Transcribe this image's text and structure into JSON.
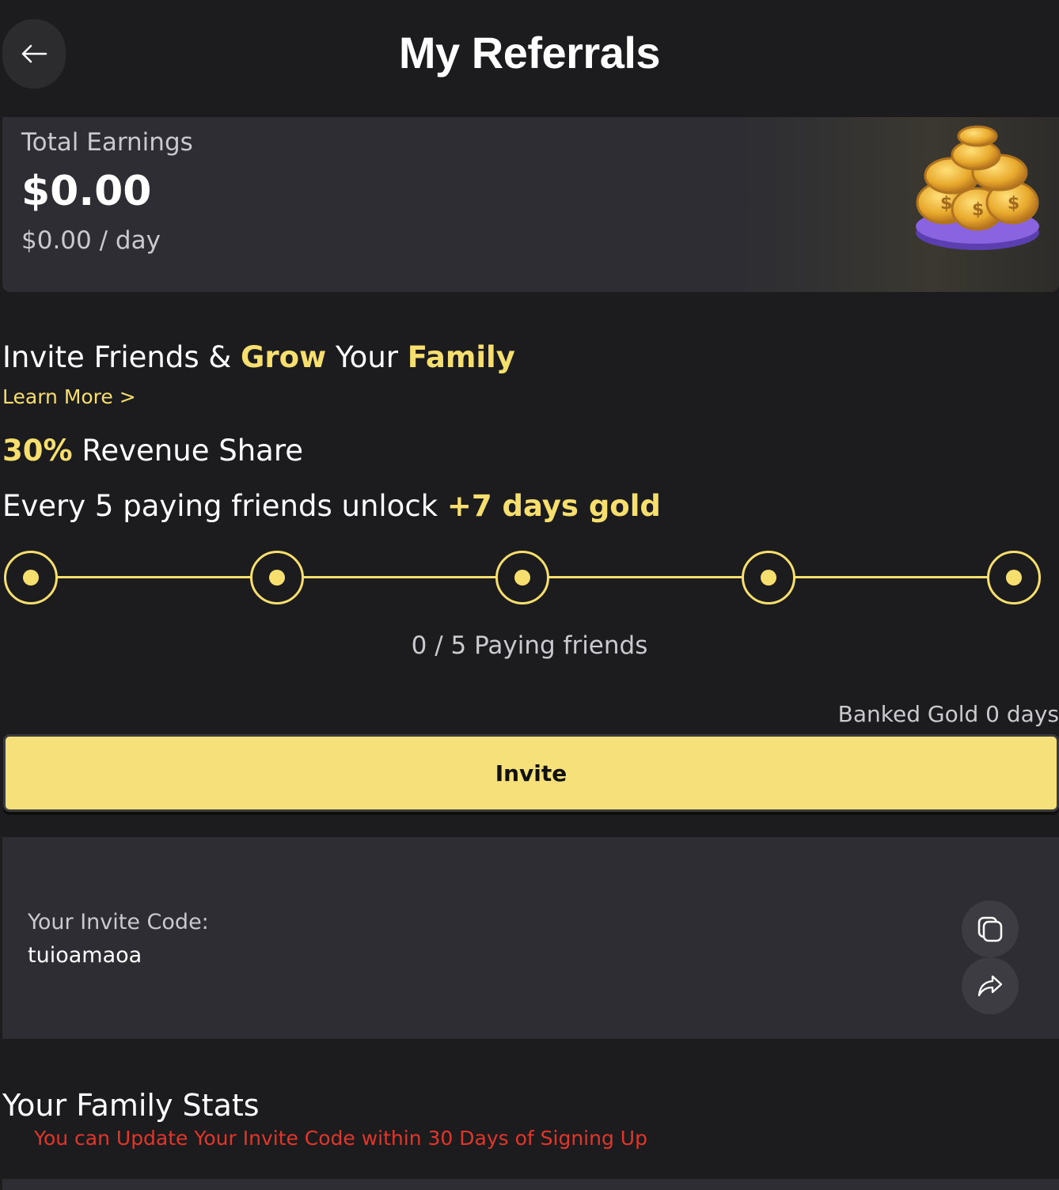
{
  "header": {
    "title": "My Referrals"
  },
  "earnings": {
    "label": "Total Earnings",
    "total": "$0.00",
    "per_day": "$0.00 / day"
  },
  "invite": {
    "heading_part1": "Invite Friends & ",
    "heading_hl1": "Grow",
    "heading_part2": " Your ",
    "heading_hl2": "Family",
    "learn_more": "Learn More >",
    "rev_share_percent": "30%",
    "rev_share_text": " Revenue Share",
    "unlock_text": "Every 5 paying friends unlock ",
    "unlock_reward": "+7 days gold",
    "progress_count": "0 / 5 Paying friends",
    "progress_steps": 5,
    "paying_friends": 0,
    "banked_gold": "Banked Gold 0 days",
    "button_label": "Invite"
  },
  "invite_code": {
    "label": "Your Invite Code:",
    "value": "tuioamaoa"
  },
  "family_stats": {
    "title": "Your Family Stats",
    "note": "You can Update Your Invite Code within 30 Days of Signing Up"
  },
  "colors": {
    "accent": "#f6df6f",
    "button": "#f5e07a",
    "warning": "#e2362b",
    "background": "#1c1c1e",
    "card": "#2d2d33"
  },
  "icons": {
    "back": "arrow-left-icon",
    "copy": "copy-icon",
    "share": "share-icon",
    "coins": "coin-stack-icon"
  }
}
